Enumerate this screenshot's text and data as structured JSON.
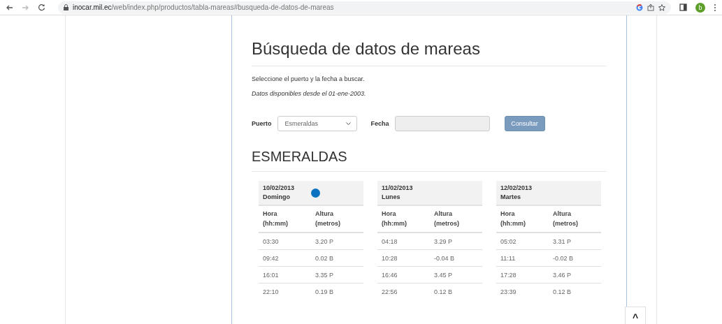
{
  "browser": {
    "url_host": "inocar.mil.ec",
    "url_path": "/web/index.php/productos/tabla-mareas#busqueda-de-datos-de-mareas",
    "profile_initial": "b"
  },
  "page": {
    "title": "Búsqueda de datos de mareas",
    "instructions": "Seleccione el puerto y la fecha a buscar.",
    "availability": "Datos disponibles desde el 01-ene-2003.",
    "form": {
      "port_label": "Puerto",
      "port_value": "Esmeraldas",
      "date_label": "Fecha",
      "submit": "Consultar"
    },
    "station": "ESMERALDAS",
    "days": [
      {
        "date": "10/02/2013",
        "weekday": "Domingo",
        "moon_phase": true,
        "columns": [
          "Hora\n(hh:mm)",
          "Altura\n(metros)"
        ],
        "rows": [
          [
            "03:30",
            "3.20 P"
          ],
          [
            "09:42",
            "0.02 B"
          ],
          [
            "16:01",
            "3.35 P"
          ],
          [
            "22:10",
            "0.19 B"
          ]
        ]
      },
      {
        "date": "11/02/2013",
        "weekday": "Lunes",
        "moon_phase": false,
        "columns": [
          "Hora\n(hh:mm)",
          "Altura\n(metros)"
        ],
        "rows": [
          [
            "04:18",
            "3.29 P"
          ],
          [
            "10:28",
            "-0.04 B"
          ],
          [
            "16:46",
            "3.45 P"
          ],
          [
            "22:56",
            "0.12 B"
          ]
        ]
      },
      {
        "date": "12/02/2013",
        "weekday": "Martes",
        "moon_phase": false,
        "columns": [
          "Hora\n(hh:mm)",
          "Altura\n(metros)"
        ],
        "rows": [
          [
            "05:02",
            "3.31 P"
          ],
          [
            "11:11",
            "-0.02 B"
          ],
          [
            "17:28",
            "3.46 P"
          ],
          [
            "23:39",
            "0.12 B"
          ]
        ]
      }
    ],
    "back_to_top": "^"
  }
}
